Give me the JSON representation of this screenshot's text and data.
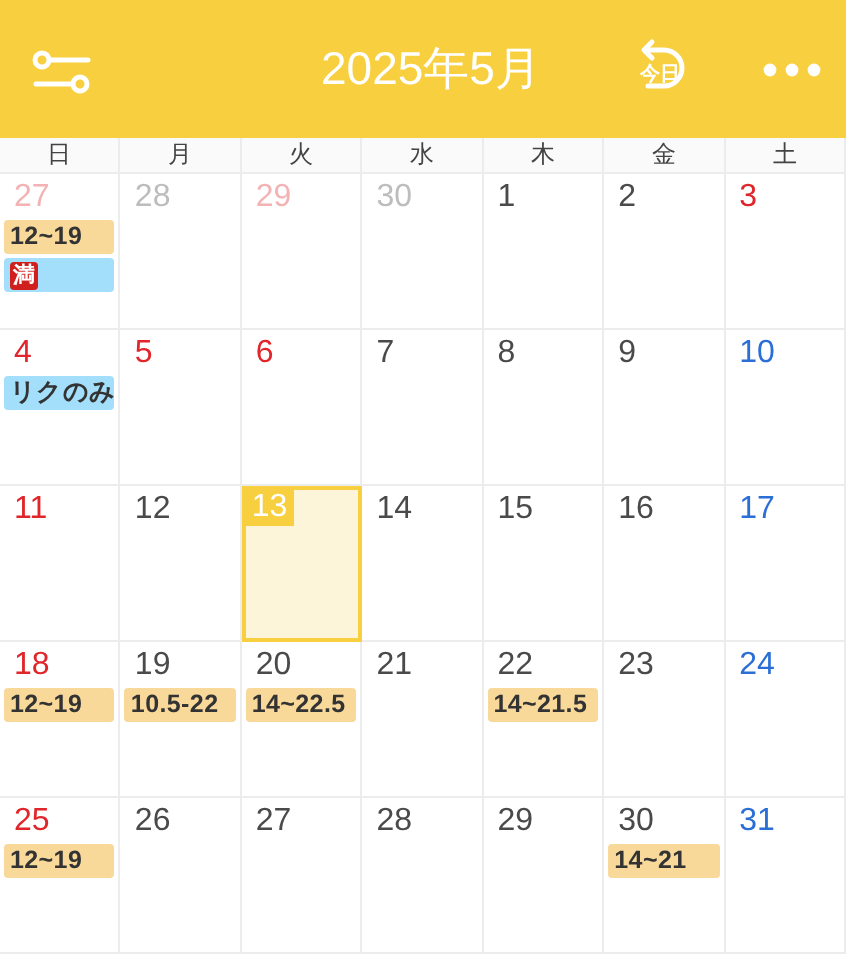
{
  "header": {
    "title": "2025年5月",
    "today_label": "今日"
  },
  "weekdays": [
    {
      "label": "日"
    },
    {
      "label": "月"
    },
    {
      "label": "火"
    },
    {
      "label": "水"
    },
    {
      "label": "木"
    },
    {
      "label": "金"
    },
    {
      "label": "土"
    }
  ],
  "weeks": [
    {
      "days": [
        {
          "day": "27",
          "color": "#f3b3b5",
          "selected": false,
          "events": [
            {
              "label": "12~19",
              "color": "#f8d99a"
            },
            {
              "badge": "満",
              "color": "#a3dffa"
            }
          ]
        },
        {
          "day": "28",
          "color": "#bdbdbd",
          "selected": false
        },
        {
          "day": "29",
          "color": "#f3b3b5",
          "selected": false
        },
        {
          "day": "30",
          "color": "#bdbdbd",
          "selected": false
        },
        {
          "day": "1",
          "color": "#4a4a4a",
          "selected": false
        },
        {
          "day": "2",
          "color": "#4a4a4a",
          "selected": false
        },
        {
          "day": "3",
          "color": "#e0262a",
          "selected": false
        }
      ]
    },
    {
      "days": [
        {
          "day": "4",
          "color": "#e0262a",
          "selected": false,
          "events": [
            {
              "label": "リクのみ",
              "color": "#a3dffa"
            }
          ]
        },
        {
          "day": "5",
          "color": "#e0262a",
          "selected": false
        },
        {
          "day": "6",
          "color": "#e0262a",
          "selected": false
        },
        {
          "day": "7",
          "color": "#4a4a4a",
          "selected": false
        },
        {
          "day": "8",
          "color": "#4a4a4a",
          "selected": false
        },
        {
          "day": "9",
          "color": "#4a4a4a",
          "selected": false
        },
        {
          "day": "10",
          "color": "#2b6fd6",
          "selected": false
        }
      ]
    },
    {
      "days": [
        {
          "day": "11",
          "color": "#e0262a",
          "selected": false
        },
        {
          "day": "12",
          "color": "#4a4a4a",
          "selected": false
        },
        {
          "day": "13",
          "color": "#ffffff",
          "selected": true
        },
        {
          "day": "14",
          "color": "#4a4a4a",
          "selected": false
        },
        {
          "day": "15",
          "color": "#4a4a4a",
          "selected": false
        },
        {
          "day": "16",
          "color": "#4a4a4a",
          "selected": false
        },
        {
          "day": "17",
          "color": "#2b6fd6",
          "selected": false
        }
      ]
    },
    {
      "days": [
        {
          "day": "18",
          "color": "#e0262a",
          "selected": false,
          "events": [
            {
              "label": "12~19",
              "color": "#f8d99a"
            }
          ]
        },
        {
          "day": "19",
          "color": "#4a4a4a",
          "selected": false,
          "events": [
            {
              "label": "10.5-22",
              "color": "#f8d99a"
            }
          ]
        },
        {
          "day": "20",
          "color": "#4a4a4a",
          "selected": false,
          "events": [
            {
              "label": "14~22.5",
              "color": "#f8d99a"
            }
          ]
        },
        {
          "day": "21",
          "color": "#4a4a4a",
          "selected": false
        },
        {
          "day": "22",
          "color": "#4a4a4a",
          "selected": false,
          "events": [
            {
              "label": "14~21.5",
              "color": "#f8d99a"
            }
          ]
        },
        {
          "day": "23",
          "color": "#4a4a4a",
          "selected": false
        },
        {
          "day": "24",
          "color": "#2b6fd6",
          "selected": false
        }
      ]
    },
    {
      "days": [
        {
          "day": "25",
          "color": "#e0262a",
          "selected": false,
          "events": [
            {
              "label": "12~19",
              "color": "#f8d99a"
            }
          ]
        },
        {
          "day": "26",
          "color": "#4a4a4a",
          "selected": false
        },
        {
          "day": "27",
          "color": "#4a4a4a",
          "selected": false
        },
        {
          "day": "28",
          "color": "#4a4a4a",
          "selected": false
        },
        {
          "day": "29",
          "color": "#4a4a4a",
          "selected": false
        },
        {
          "day": "30",
          "color": "#4a4a4a",
          "selected": false,
          "events": [
            {
              "label": "14~21",
              "color": "#f8d99a"
            }
          ]
        },
        {
          "day": "31",
          "color": "#2b6fd6",
          "selected": false
        }
      ]
    }
  ]
}
